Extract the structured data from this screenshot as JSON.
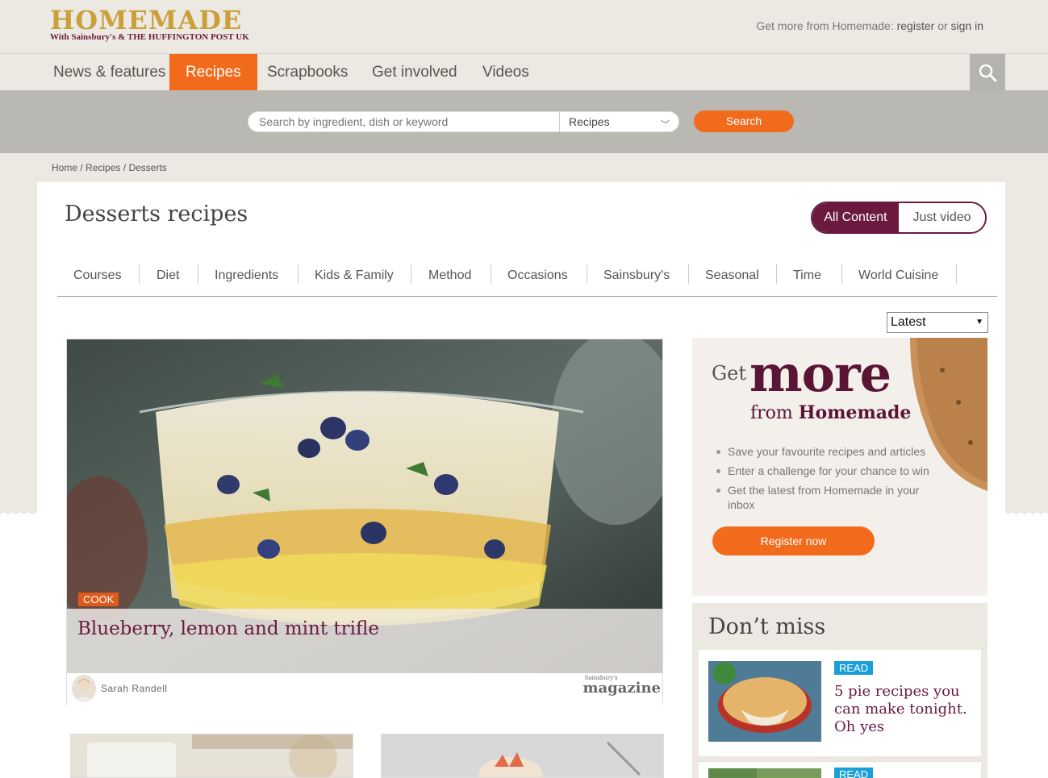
{
  "header": {
    "logo_word": "HOMEMADE",
    "logo_sub": "With Sainsbury's & THE HUFFINGTON POST UK",
    "account_prefix": "Get more from Homemade:",
    "register_label": "register",
    "or_label": "or",
    "signin_label": "sign in"
  },
  "nav": {
    "items": [
      {
        "label": "News & features"
      },
      {
        "label": "Recipes"
      },
      {
        "label": "Scrapbooks"
      },
      {
        "label": "Get involved"
      },
      {
        "label": "Videos"
      }
    ],
    "active": "Recipes",
    "search_icon": "search-icon"
  },
  "search": {
    "placeholder": "Search by ingredient, dish or keyword",
    "scope_value": "Recipes",
    "button_label": "Search"
  },
  "breadcrumb": {
    "items": [
      "Home",
      "Recipes",
      "Desserts"
    ],
    "separator": "/"
  },
  "page": {
    "title": "Desserts recipes",
    "toggle_on": "All Content",
    "toggle_off": "Just video",
    "filters": [
      "Courses",
      "Diet",
      "Ingredients",
      "Kids & Family",
      "Method",
      "Occasions",
      "Sainsbury's",
      "Seasonal",
      "Time",
      "World Cuisine"
    ],
    "sort_value": "Latest"
  },
  "feature": {
    "tag": "COOK",
    "title": "Blueberry, lemon and mint trifle",
    "author": "Sarah Randell",
    "source_small": "Sainsbury's",
    "source": "magazine"
  },
  "promo": {
    "get": "Get",
    "more": "more",
    "from": "from",
    "brand": "Homemade",
    "bullets": [
      "Save your favourite recipes and articles",
      "Enter a challenge for your chance to win",
      "Get the latest from Homemade in your inbox"
    ],
    "button_label": "Register now"
  },
  "dont_miss": {
    "title": "Don’t miss",
    "items": [
      {
        "tag": "READ",
        "title": "5 pie recipes you can make tonight. Oh yes"
      },
      {
        "tag": "READ",
        "title": ""
      }
    ]
  },
  "colors": {
    "accent_orange": "#f26b1d",
    "brand_plum": "#6b1a3f",
    "read_blue": "#1aa0d8",
    "background": "#ece9e2"
  }
}
